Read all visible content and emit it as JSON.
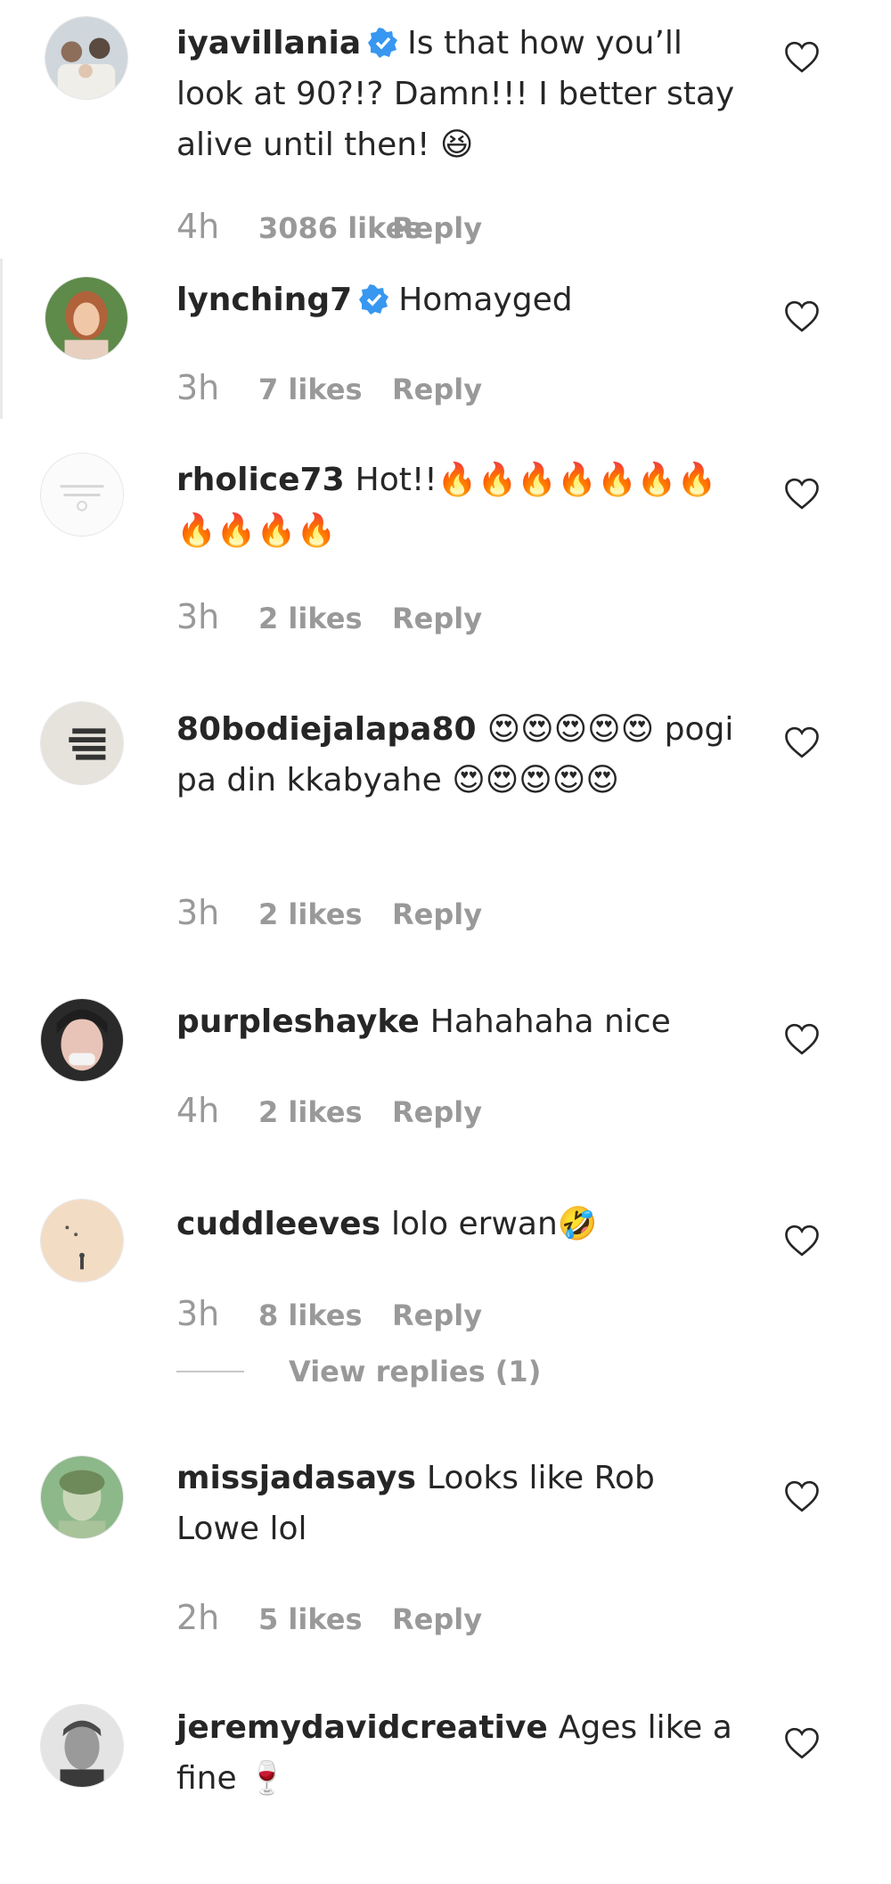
{
  "comments": [
    {
      "username": "iyavillania",
      "verified": true,
      "text": "Is that how you’ll look at 90?!? Damn!!! I better stay alive until then! 😆",
      "time": "4h",
      "likes": "3086 likes",
      "reply": "Reply"
    },
    {
      "username": "lynching7",
      "verified": true,
      "text": "Homayged",
      "time": "3h",
      "likes": "7 likes",
      "reply": "Reply"
    },
    {
      "username": "rholice73",
      "verified": false,
      "text": "Hot!!🔥🔥🔥🔥🔥🔥🔥🔥🔥🔥🔥",
      "time": "3h",
      "likes": "2 likes",
      "reply": "Reply"
    },
    {
      "username": "80bodiejalapa80",
      "verified": false,
      "text": "😍😍😍😍😍 pogi pa din kkabyahe 😍😍😍😍😍",
      "time": "3h",
      "likes": "2 likes",
      "reply": "Reply"
    },
    {
      "username": "purpleshayke",
      "verified": false,
      "text": "Hahahaha nice",
      "time": "4h",
      "likes": "2 likes",
      "reply": "Reply"
    },
    {
      "username": "cuddleeves",
      "verified": false,
      "text": "lolo erwan🤣",
      "time": "3h",
      "likes": "8 likes",
      "reply": "Reply",
      "view_replies": "View replies (1)"
    },
    {
      "username": "missjadasays",
      "verified": false,
      "text": "Looks like Rob Lowe lol",
      "time": "2h",
      "likes": "5 likes",
      "reply": "Reply"
    },
    {
      "username": "jeremydavidcreative",
      "verified": false,
      "text": "Ages like a fine 🍷"
    }
  ],
  "icons": {
    "verified": "verified-badge-icon",
    "like": "heart-icon"
  },
  "colors": {
    "verified": "#3897f0",
    "muted": "#999999",
    "text": "#262626"
  }
}
